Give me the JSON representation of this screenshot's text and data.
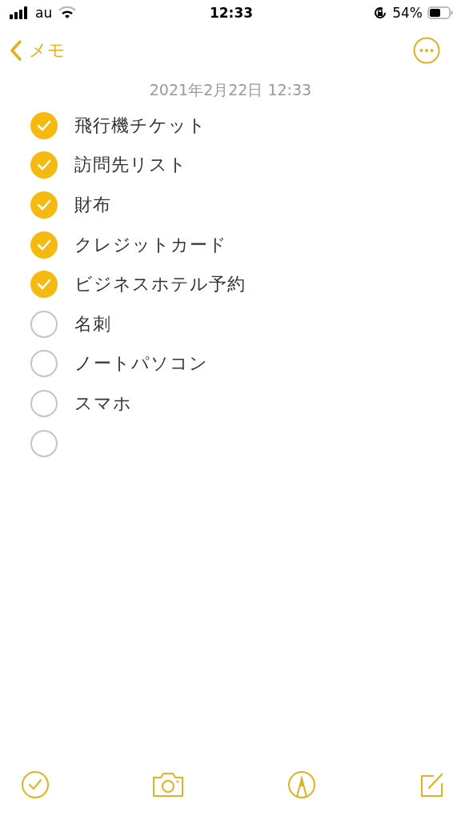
{
  "status_bar": {
    "carrier": "au",
    "time": "12:33",
    "battery": "54%"
  },
  "nav": {
    "back_label": "メモ"
  },
  "note": {
    "date": "2021年2月22日 12:33",
    "items": [
      {
        "text": "飛行機チケット",
        "checked": true
      },
      {
        "text": "訪問先リスト",
        "checked": true
      },
      {
        "text": "財布",
        "checked": true
      },
      {
        "text": "クレジットカード",
        "checked": true
      },
      {
        "text": "ビジネスホテル予約",
        "checked": true
      },
      {
        "text": "名刺",
        "checked": false
      },
      {
        "text": "ノートパソコン",
        "checked": false
      },
      {
        "text": "スマホ",
        "checked": false
      },
      {
        "checked": false
      }
    ]
  }
}
